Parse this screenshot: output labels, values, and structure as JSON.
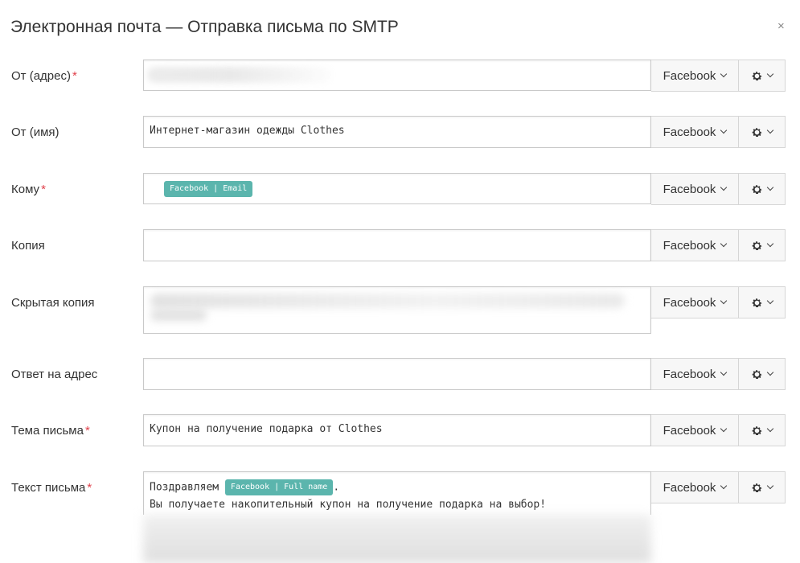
{
  "dialog": {
    "title": "Электронная почта — Отправка письма по SMTP",
    "close_glyph": "×"
  },
  "source_dropdown_label": "Facebook",
  "gear_icon": "gear-icon",
  "required_mark": "*",
  "fields": {
    "from_address": {
      "label": "От (адрес)",
      "required": true,
      "value": ""
    },
    "from_name": {
      "label": "От (имя)",
      "required": false,
      "value": "Интернет-магазин одежды Clothes"
    },
    "to": {
      "label": "Кому",
      "required": true,
      "chip": "Facebook | Email"
    },
    "cc": {
      "label": "Копия",
      "required": false,
      "value": ""
    },
    "bcc": {
      "label": "Скрытая копия",
      "required": false,
      "value": ""
    },
    "reply_to": {
      "label": "Ответ на адрес",
      "required": false,
      "value": ""
    },
    "subject": {
      "label": "Тема письма",
      "required": true,
      "value": "Купон на получение подарка от Clothes"
    },
    "body": {
      "label": "Текст письма",
      "required": true,
      "line1_prefix": "Поздравляем",
      "line1_chip": "Facebook | Full name",
      "line1_suffix": ".",
      "line2": "Вы получаете накопительный купон на получение подарка на выбор!"
    }
  },
  "colors": {
    "chip": "#5bb5ad",
    "required": "#e0404a"
  }
}
